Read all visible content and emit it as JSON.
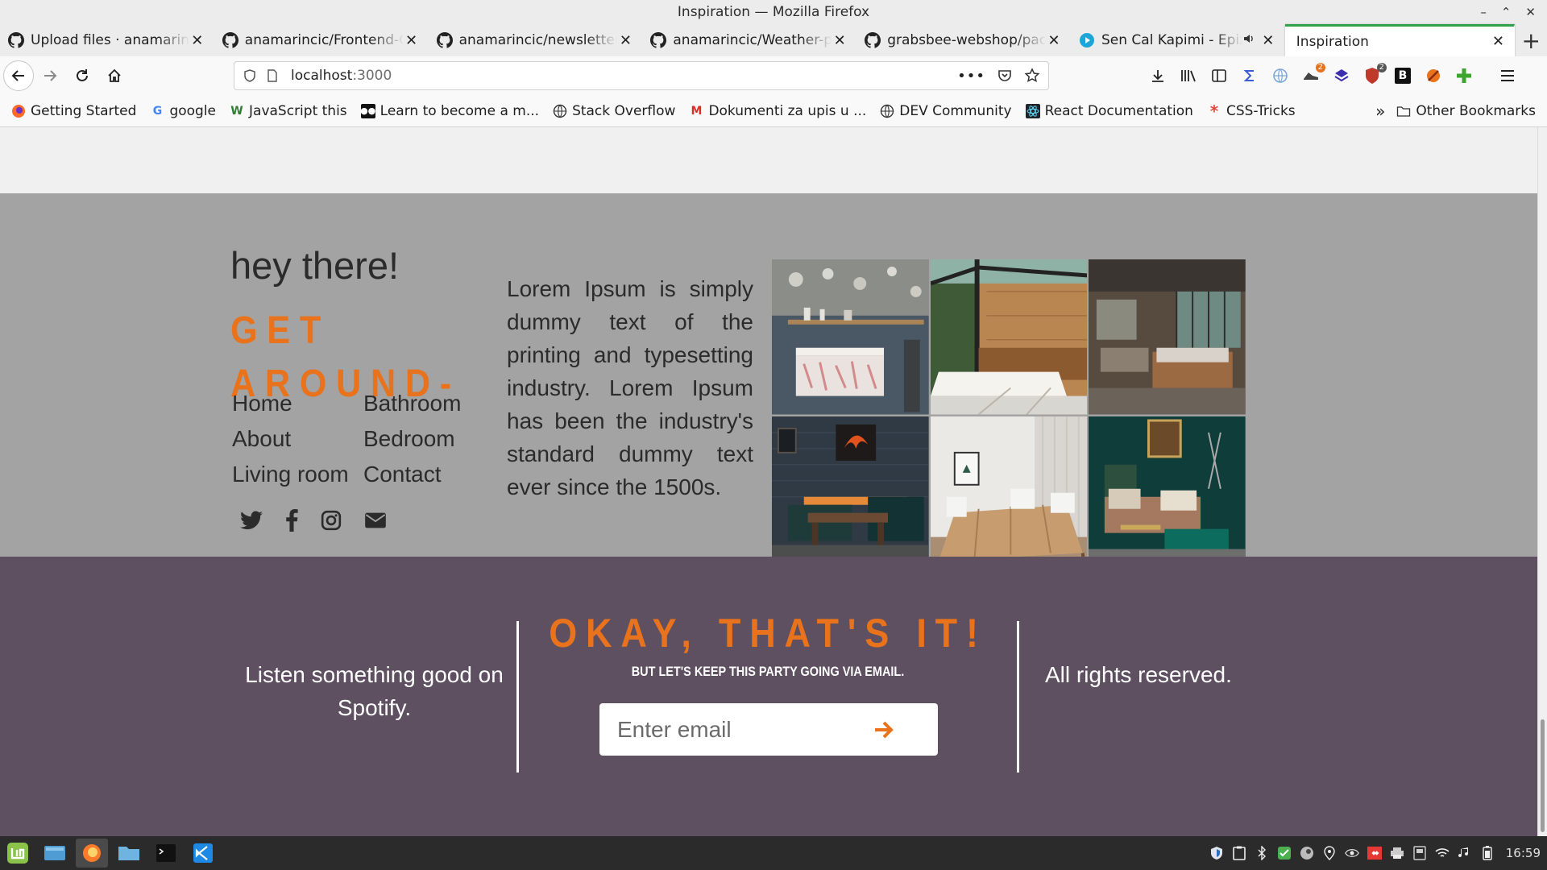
{
  "window": {
    "title": "Inspiration — Mozilla Firefox"
  },
  "tabs": [
    {
      "label": "Upload files · anamarincic",
      "icon": "github-icon"
    },
    {
      "label": "anamarincic/Frontend-C",
      "icon": "github-icon"
    },
    {
      "label": "anamarincic/newsletter-",
      "icon": "github-icon"
    },
    {
      "label": "anamarincic/Weather-pr",
      "icon": "github-icon"
    },
    {
      "label": "grabsbee-webshop/pack",
      "icon": "github-icon"
    },
    {
      "label": "Sen Cal Kapimi - Epizo",
      "icon": "play-icon"
    },
    {
      "label": "Inspiration",
      "icon": ""
    }
  ],
  "urlbar": {
    "host": "localhost",
    "port": ":3000"
  },
  "bookmarks": [
    {
      "label": "Getting Started"
    },
    {
      "label": "google"
    },
    {
      "label": "JavaScript this"
    },
    {
      "label": "Learn to become a m..."
    },
    {
      "label": "Stack Overflow"
    },
    {
      "label": "Dokumenti za upis u ..."
    },
    {
      "label": "DEV Community"
    },
    {
      "label": "React Documentation"
    },
    {
      "label": "CSS-Tricks"
    }
  ],
  "bookmarks_other": "Other Bookmarks",
  "toolbar_badges": {
    "extension_a": "2",
    "extension_b": "2"
  },
  "page": {
    "greeting": "hey there!",
    "nav_heading": "GET AROUND-",
    "nav_links": [
      "Home",
      "Bathroom",
      "About",
      "Bedroom",
      "Living room",
      "Contact"
    ],
    "lorem": "Lorem Ipsum is simply dummy text of the printing and typesetting industry. Lorem Ipsum has been the industry's standard dummy text ever since the 1500s.",
    "footer": {
      "spotify": "Listen something good on Spotify.",
      "headline": "OKAY, THAT'S IT!",
      "subline": "BUT LET'S KEEP THIS PARTY GOING VIA EMAIL.",
      "email_placeholder": "Enter email",
      "rights": "All rights reserved."
    }
  },
  "taskbar": {
    "clock": "16:59"
  },
  "colors": {
    "accent": "#e8731c",
    "gray_section": "#a3a3a3",
    "footer_bg": "#5e4f61"
  }
}
